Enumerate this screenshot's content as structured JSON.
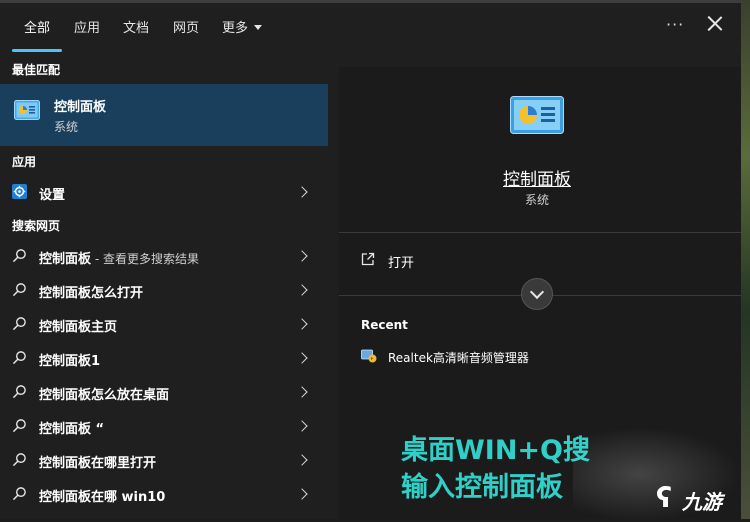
{
  "tabs": [
    {
      "label": "全部",
      "active": true
    },
    {
      "label": "应用"
    },
    {
      "label": "文档"
    },
    {
      "label": "网页"
    },
    {
      "label": "更多"
    }
  ],
  "window": {
    "more_icon": "ellipsis-icon",
    "close_icon": "close-icon"
  },
  "sections": {
    "best_match": "最佳匹配",
    "apps": "应用",
    "web": "搜索网页"
  },
  "best_match": {
    "title": "控制面板",
    "subtitle": "系统",
    "icon": "control-panel-icon"
  },
  "apps": [
    {
      "label": "设置",
      "icon": "gear-icon"
    }
  ],
  "web_results": [
    {
      "label": "控制面板",
      "suffix": " - 查看更多搜索结果"
    },
    {
      "label": "控制面板怎么打开"
    },
    {
      "label": "控制面板主页"
    },
    {
      "label": "控制面板1"
    },
    {
      "label": "控制面板怎么放在桌面"
    },
    {
      "label": "控制面板 “"
    },
    {
      "label": "控制面板在哪里打开"
    },
    {
      "label": "控制面板在哪 win10"
    }
  ],
  "preview": {
    "title": "控制面板",
    "subtitle": "系统",
    "open_label": "打开",
    "recent_label": "Recent",
    "recent_items": [
      {
        "label": "Realtek高清晰音频管理器",
        "icon": "audio-manager-icon"
      }
    ]
  },
  "overlay": {
    "line1": "桌面WIN+Q搜",
    "line2": "输入控制面板"
  },
  "watermark": {
    "text": "九游"
  },
  "colors": {
    "accent": "#4cc2ff",
    "selected": "#1a3f5c",
    "overlay_text": "#2fd0c8"
  }
}
